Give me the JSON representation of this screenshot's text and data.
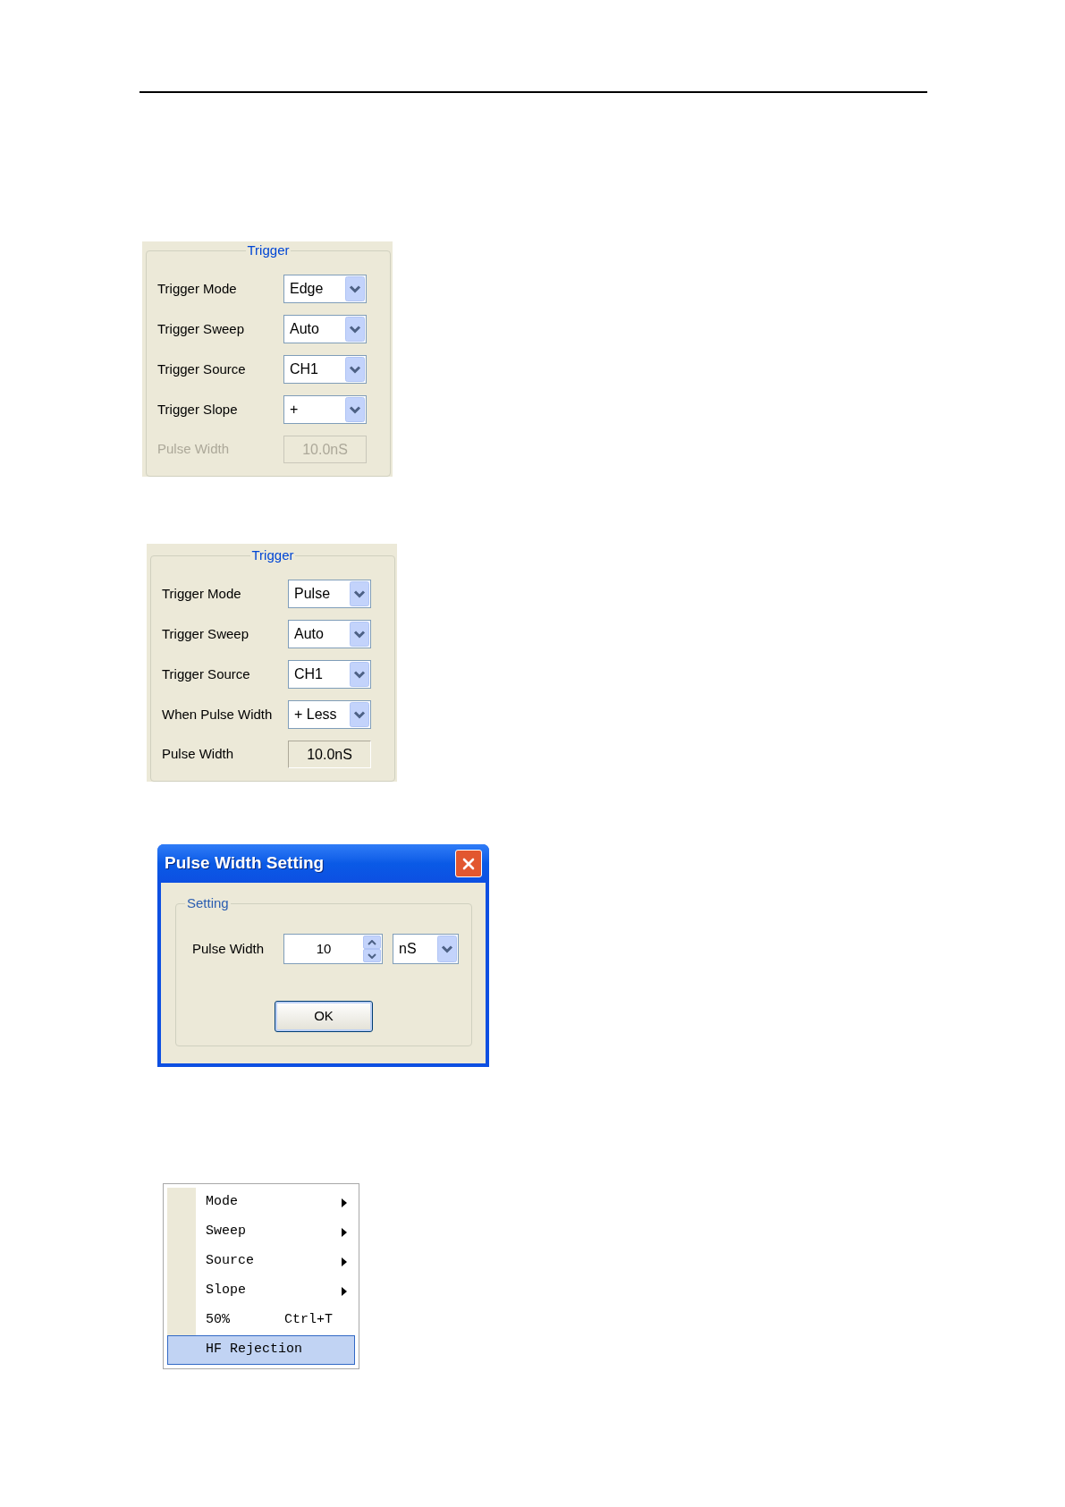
{
  "trigger_panels": [
    {
      "title": "Trigger",
      "rows": [
        {
          "kind": "dropdown",
          "label": "Trigger Mode",
          "value": "Edge",
          "disabled": false
        },
        {
          "kind": "dropdown",
          "label": "Trigger Sweep",
          "value": "Auto",
          "disabled": false
        },
        {
          "kind": "dropdown",
          "label": "Trigger Source",
          "value": "CH1",
          "disabled": false
        },
        {
          "kind": "dropdown",
          "label": "Trigger Slope",
          "value": "+",
          "disabled": false
        },
        {
          "kind": "field",
          "label": "Pulse Width",
          "value": "10.0nS",
          "disabled": true
        }
      ]
    },
    {
      "title": "Trigger",
      "rows": [
        {
          "kind": "dropdown",
          "label": "Trigger Mode",
          "value": "Pulse",
          "disabled": false
        },
        {
          "kind": "dropdown",
          "label": "Trigger Sweep",
          "value": "Auto",
          "disabled": false
        },
        {
          "kind": "dropdown",
          "label": "Trigger Source",
          "value": "CH1",
          "disabled": false
        },
        {
          "kind": "dropdown",
          "label": "When Pulse Width",
          "value": "+ Less",
          "disabled": false
        },
        {
          "kind": "field",
          "label": "Pulse Width",
          "value": "10.0nS",
          "disabled": false
        }
      ]
    }
  ],
  "dialog": {
    "title": "Pulse Width Setting",
    "group_title": "Setting",
    "field": {
      "label": "Pulse Width",
      "value": "10",
      "unit": "nS"
    },
    "button": "OK"
  },
  "context_menu": {
    "items": [
      {
        "label": "Mode",
        "submenu": true,
        "selected": false
      },
      {
        "label": "Sweep",
        "submenu": true,
        "selected": false
      },
      {
        "label": "Source",
        "submenu": true,
        "selected": false
      },
      {
        "label": "Slope",
        "submenu": true,
        "selected": false
      },
      {
        "label": "50%",
        "shortcut": "Ctrl+T",
        "submenu": false,
        "selected": false
      },
      {
        "label": "HF Rejection",
        "submenu": false,
        "selected": true
      }
    ]
  }
}
